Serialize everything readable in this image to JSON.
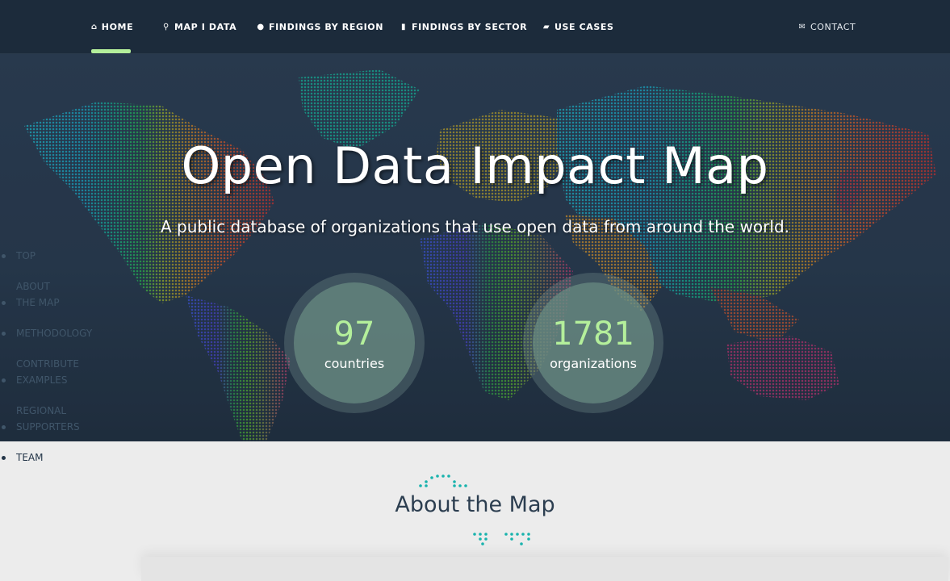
{
  "nav": {
    "items": [
      {
        "label": "HOME",
        "icon": "home-icon",
        "glyph": "⌂"
      },
      {
        "label": "MAP I DATA",
        "icon": "map-marker-icon",
        "glyph": "⚲"
      },
      {
        "label": "FINDINGS BY REGION",
        "icon": "globe-icon",
        "glyph": "●"
      },
      {
        "label": "FINDINGS BY SECTOR",
        "icon": "bookmark-icon",
        "glyph": "▮"
      },
      {
        "label": "USE CASES",
        "icon": "book-icon",
        "glyph": "▰"
      }
    ],
    "contact": {
      "label": "CONTACT",
      "icon": "envelope-icon",
      "glyph": "✉"
    }
  },
  "hero": {
    "title": "Open Data Impact Map",
    "subtitle": "A public database of organizations that use open data from around the world.",
    "stats": [
      {
        "value": "97",
        "label": "countries"
      },
      {
        "value": "1781",
        "label": "organizations"
      }
    ]
  },
  "sidenav": {
    "items": [
      {
        "lines": [
          "TOP"
        ]
      },
      {
        "lines": [
          "ABOUT",
          "THE MAP"
        ]
      },
      {
        "lines": [
          "METHODOLOGY"
        ]
      },
      {
        "lines": [
          "CONTRIBUTE",
          "EXAMPLES"
        ]
      },
      {
        "lines": [
          "REGIONAL",
          "SUPPORTERS"
        ]
      },
      {
        "lines": [
          "TEAM"
        ]
      }
    ]
  },
  "about": {
    "title": "About the Map"
  },
  "colors": {
    "nav_bg": "#1c2b3b",
    "accent_green": "#b4ef9b",
    "teal_dots": "#19b3ad",
    "heading": "#2c3e50"
  }
}
